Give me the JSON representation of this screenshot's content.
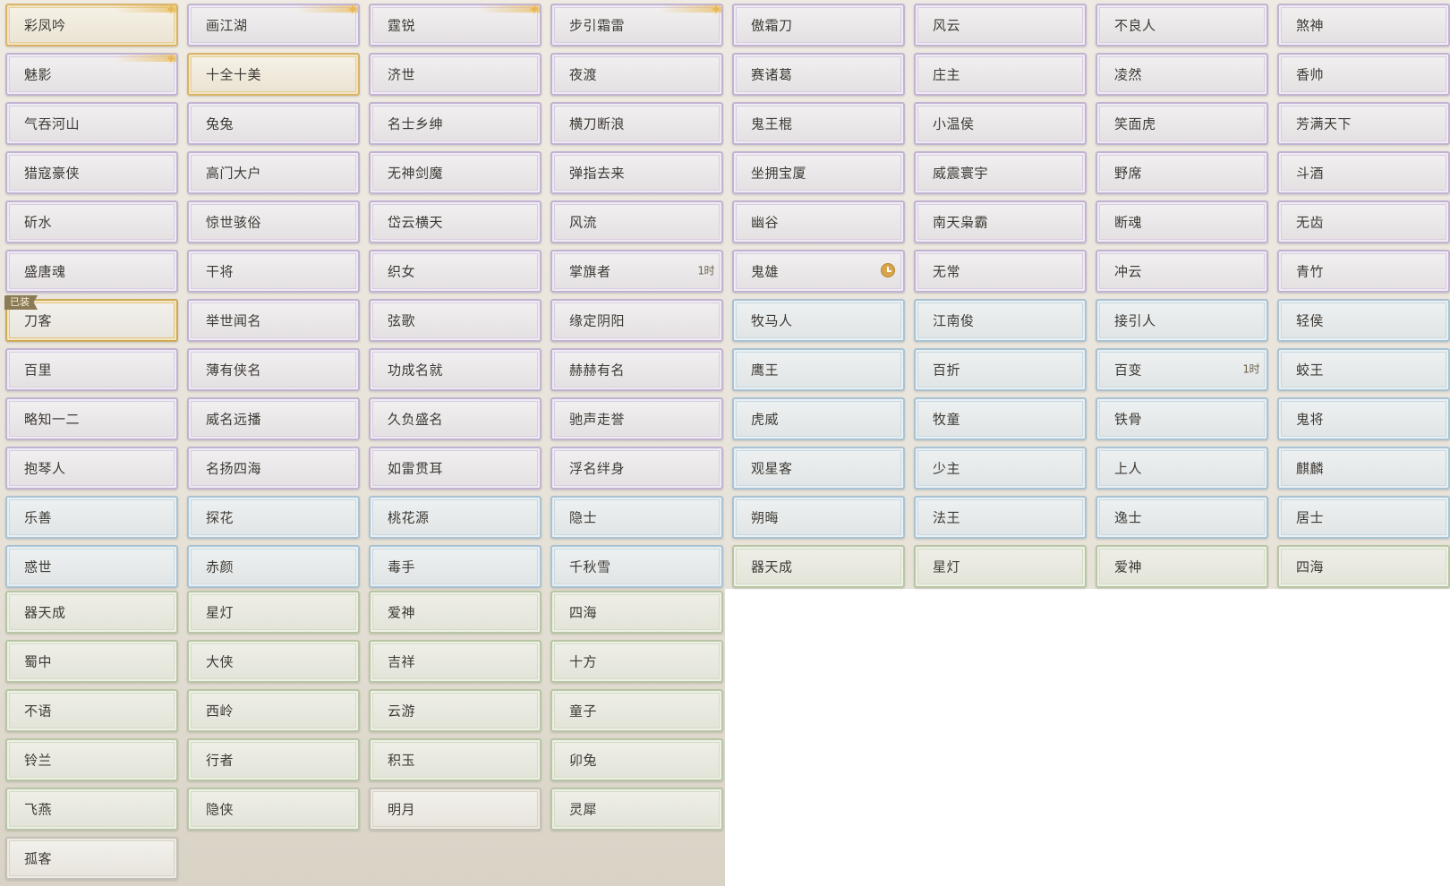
{
  "titles": [
    {
      "label": "彩凤吟",
      "tier": "gold",
      "corner": true
    },
    {
      "label": "画江湖",
      "tier": "purple",
      "corner": true
    },
    {
      "label": "霆锐",
      "tier": "purple",
      "corner": true
    },
    {
      "label": "步引霜雷",
      "tier": "purple",
      "corner": true
    },
    {
      "label": "傲霜刀",
      "tier": "purple"
    },
    {
      "label": "风云",
      "tier": "purple"
    },
    {
      "label": "不良人",
      "tier": "purple"
    },
    {
      "label": "煞神",
      "tier": "purple"
    },
    {
      "label": "魅影",
      "tier": "purple",
      "corner": true
    },
    {
      "label": "十全十美",
      "tier": "gold"
    },
    {
      "label": "济世",
      "tier": "purple"
    },
    {
      "label": "夜渡",
      "tier": "purple"
    },
    {
      "label": "赛诸葛",
      "tier": "purple"
    },
    {
      "label": "庄主",
      "tier": "purple"
    },
    {
      "label": "凌然",
      "tier": "purple"
    },
    {
      "label": "香帅",
      "tier": "purple"
    },
    {
      "label": "气吞河山",
      "tier": "purple"
    },
    {
      "label": "兔兔",
      "tier": "purple"
    },
    {
      "label": "名士乡绅",
      "tier": "purple"
    },
    {
      "label": "横刀断浪",
      "tier": "purple"
    },
    {
      "label": "鬼王棍",
      "tier": "purple"
    },
    {
      "label": "小温侯",
      "tier": "purple"
    },
    {
      "label": "笑面虎",
      "tier": "purple"
    },
    {
      "label": "芳满天下",
      "tier": "purple"
    },
    {
      "label": "猎寇豪侠",
      "tier": "purple"
    },
    {
      "label": "高门大户",
      "tier": "purple"
    },
    {
      "label": "无神剑魔",
      "tier": "purple"
    },
    {
      "label": "弹指去来",
      "tier": "purple"
    },
    {
      "label": "坐拥宝厦",
      "tier": "purple"
    },
    {
      "label": "威震寰宇",
      "tier": "purple"
    },
    {
      "label": "野席",
      "tier": "purple"
    },
    {
      "label": "斗酒",
      "tier": "purple"
    },
    {
      "label": "斫水",
      "tier": "purple"
    },
    {
      "label": "惊世骇俗",
      "tier": "purple"
    },
    {
      "label": "岱云横天",
      "tier": "purple"
    },
    {
      "label": "风流",
      "tier": "purple"
    },
    {
      "label": "幽谷",
      "tier": "purple"
    },
    {
      "label": "南天枭霸",
      "tier": "purple"
    },
    {
      "label": "断魂",
      "tier": "purple"
    },
    {
      "label": "无齿",
      "tier": "purple"
    },
    {
      "label": "盛唐魂",
      "tier": "purple"
    },
    {
      "label": "干将",
      "tier": "purple"
    },
    {
      "label": "织女",
      "tier": "purple"
    },
    {
      "label": "掌旗者",
      "tier": "purple",
      "timer": "1时"
    },
    {
      "label": "鬼雄",
      "tier": "purple",
      "clock": true
    },
    {
      "label": "无常",
      "tier": "purple"
    },
    {
      "label": "冲云",
      "tier": "purple"
    },
    {
      "label": "青竹",
      "tier": "purple"
    },
    {
      "label": "刀客",
      "tier": "gray",
      "equipped": true
    },
    {
      "label": "举世闻名",
      "tier": "purple"
    },
    {
      "label": "弦歌",
      "tier": "purple"
    },
    {
      "label": "缘定阴阳",
      "tier": "purple"
    },
    {
      "label": "牧马人",
      "tier": "blue"
    },
    {
      "label": "江南俊",
      "tier": "blue"
    },
    {
      "label": "接引人",
      "tier": "blue"
    },
    {
      "label": "轻侯",
      "tier": "blue"
    },
    {
      "label": "百里",
      "tier": "purple"
    },
    {
      "label": "薄有侠名",
      "tier": "purple"
    },
    {
      "label": "功成名就",
      "tier": "purple"
    },
    {
      "label": "赫赫有名",
      "tier": "purple"
    },
    {
      "label": "鹰王",
      "tier": "blue"
    },
    {
      "label": "百折",
      "tier": "blue"
    },
    {
      "label": "百变",
      "tier": "blue",
      "timer": "1时"
    },
    {
      "label": "蛟王",
      "tier": "blue"
    },
    {
      "label": "略知一二",
      "tier": "purple"
    },
    {
      "label": "威名远播",
      "tier": "purple"
    },
    {
      "label": "久负盛名",
      "tier": "purple"
    },
    {
      "label": "驰声走誉",
      "tier": "purple"
    },
    {
      "label": "虎威",
      "tier": "blue"
    },
    {
      "label": "牧童",
      "tier": "blue"
    },
    {
      "label": "铁骨",
      "tier": "blue"
    },
    {
      "label": "鬼将",
      "tier": "blue"
    },
    {
      "label": "抱琴人",
      "tier": "purple"
    },
    {
      "label": "名扬四海",
      "tier": "purple"
    },
    {
      "label": "如雷贯耳",
      "tier": "purple"
    },
    {
      "label": "浮名绊身",
      "tier": "purple"
    },
    {
      "label": "观星客",
      "tier": "blue"
    },
    {
      "label": "少主",
      "tier": "blue"
    },
    {
      "label": "上人",
      "tier": "blue"
    },
    {
      "label": "麒麟",
      "tier": "blue"
    },
    {
      "label": "乐善",
      "tier": "blue"
    },
    {
      "label": "探花",
      "tier": "blue"
    },
    {
      "label": "桃花源",
      "tier": "blue"
    },
    {
      "label": "隐士",
      "tier": "blue"
    },
    {
      "label": "朔晦",
      "tier": "blue"
    },
    {
      "label": "法王",
      "tier": "blue"
    },
    {
      "label": "逸士",
      "tier": "blue"
    },
    {
      "label": "居士",
      "tier": "blue"
    },
    {
      "label": "惑世",
      "tier": "blue"
    },
    {
      "label": "赤颜",
      "tier": "blue"
    },
    {
      "label": "毒手",
      "tier": "blue"
    },
    {
      "label": "千秋雪",
      "tier": "blue"
    },
    {
      "label": "器天成",
      "tier": "green"
    },
    {
      "label": "星灯",
      "tier": "green"
    },
    {
      "label": "爱神",
      "tier": "green"
    },
    {
      "label": "四海",
      "tier": "green"
    },
    {
      "label": "器天成",
      "tier": "green"
    },
    {
      "label": "星灯",
      "tier": "green"
    },
    {
      "label": "爱神",
      "tier": "green"
    },
    {
      "label": "四海",
      "tier": "green"
    },
    {
      "label": "蜀中",
      "tier": "green"
    },
    {
      "label": "大侠",
      "tier": "green"
    },
    {
      "label": "吉祥",
      "tier": "green"
    },
    {
      "label": "十方",
      "tier": "green"
    },
    {
      "label": "不语",
      "tier": "green"
    },
    {
      "label": "西岭",
      "tier": "green"
    },
    {
      "label": "云游",
      "tier": "green"
    },
    {
      "label": "童子",
      "tier": "green"
    },
    {
      "label": "铃兰",
      "tier": "green"
    },
    {
      "label": "行者",
      "tier": "green"
    },
    {
      "label": "积玉",
      "tier": "green"
    },
    {
      "label": "卯兔",
      "tier": "green"
    },
    {
      "label": "飞燕",
      "tier": "green"
    },
    {
      "label": "隐侠",
      "tier": "green"
    },
    {
      "label": "明月",
      "tier": "gray"
    },
    {
      "label": "灵犀",
      "tier": "green"
    },
    {
      "label": "孤客",
      "tier": "gray"
    }
  ],
  "equipped_badge": "已装"
}
